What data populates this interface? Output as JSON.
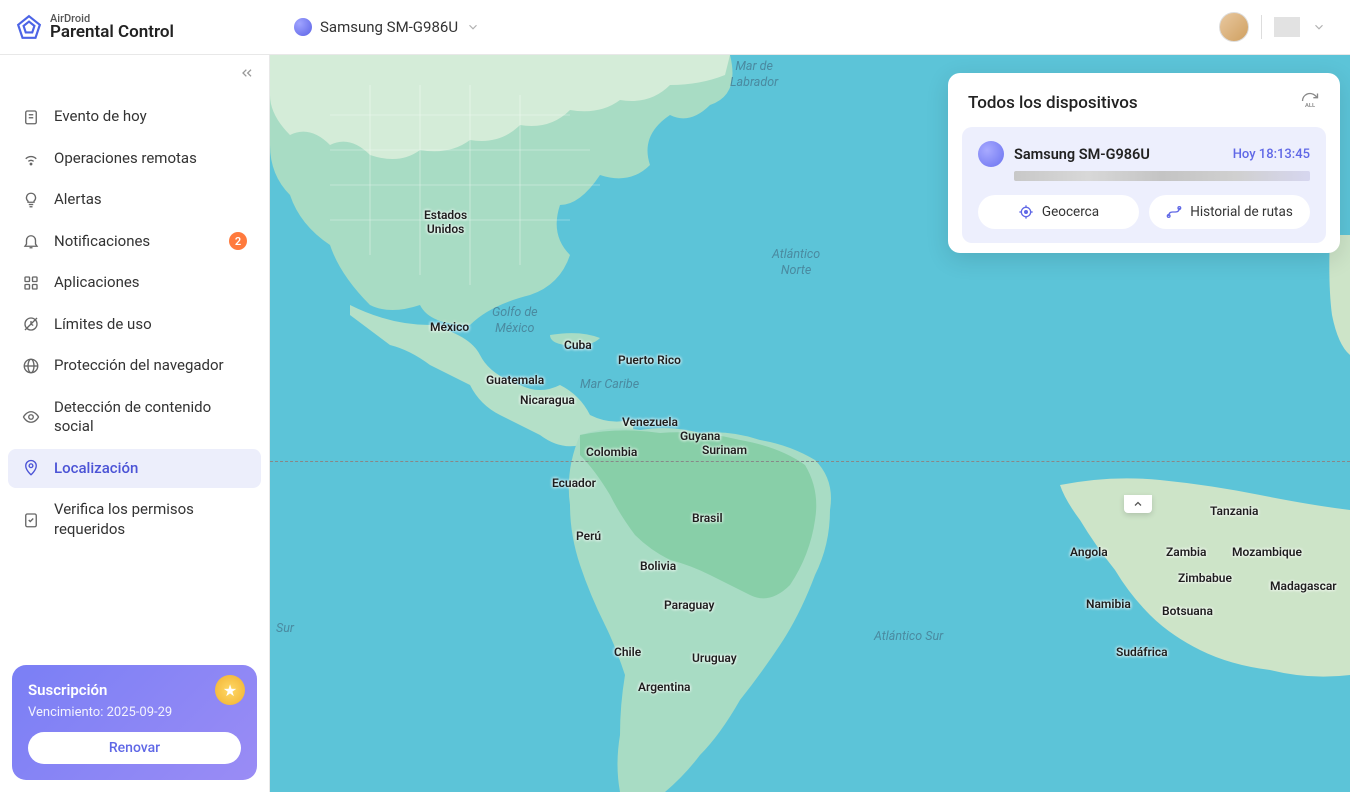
{
  "header": {
    "brand": "AirDroid",
    "product": "Parental Control",
    "device_name": "Samsung SM-G986U"
  },
  "sidebar": {
    "items": [
      {
        "label": "Evento de hoy",
        "icon": "clipboard"
      },
      {
        "label": "Operaciones remotas",
        "icon": "wifi"
      },
      {
        "label": "Alertas",
        "icon": "lightbulb"
      },
      {
        "label": "Notificaciones",
        "icon": "bell",
        "badge": "2"
      },
      {
        "label": "Aplicaciones",
        "icon": "grid"
      },
      {
        "label": "Límites de uso",
        "icon": "clock-limit"
      },
      {
        "label": "Protección del navegador",
        "icon": "globe"
      },
      {
        "label": "Detección de contenido social",
        "icon": "eye"
      },
      {
        "label": "Localización",
        "icon": "location",
        "active": true
      },
      {
        "label": "Verifica los permisos requeridos",
        "icon": "checklist"
      }
    ]
  },
  "subscription": {
    "title": "Suscripción",
    "expiry_label": "Vencimiento: 2025-09-29",
    "renew_button": "Renovar"
  },
  "devices_panel": {
    "title": "Todos los dispositivos",
    "device_name": "Samsung SM-G986U",
    "timestamp": "Hoy 18:13:45",
    "geofence_button": "Geocerca",
    "route_history_button": "Historial de rutas"
  },
  "map": {
    "ocean_mar_labrador": "Mar de\nLabrador",
    "ocean_atl_norte": "Atlántico\nNorte",
    "ocean_gulf": "Golfo de\nMéxico",
    "ocean_caribe": "Mar Caribe",
    "ocean_atl_sur": "Atlántico Sur",
    "countries": {
      "estados_unidos": "Estados\nUnidos",
      "mexico": "México",
      "cuba": "Cuba",
      "puerto_rico": "Puerto Rico",
      "guatemala": "Guatemala",
      "nicaragua": "Nicaragua",
      "venezuela": "Venezuela",
      "guyana": "Guyana",
      "surinam": "Surinam",
      "colombia": "Colombia",
      "ecuador": "Ecuador",
      "brasil": "Brasil",
      "peru": "Perú",
      "bolivia": "Bolivia",
      "paraguay": "Paraguay",
      "chile": "Chile",
      "argentina": "Argentina",
      "uruguay": "Uruguay",
      "angola": "Angola",
      "namibia": "Namibia",
      "botsuana": "Botsuana",
      "sudafrica": "Sudáfrica",
      "zambia": "Zambia",
      "zimbabue": "Zimbabue",
      "tanzania": "Tanzania",
      "mozambique": "Mozambique",
      "madagascar": "Madagascar"
    }
  }
}
